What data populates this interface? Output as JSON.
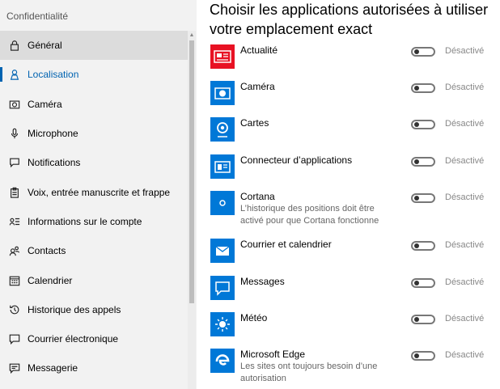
{
  "sidebar": {
    "title": "Confidentialité",
    "items": [
      {
        "label": "Général",
        "icon": "lock-icon"
      },
      {
        "label": "Localisation",
        "icon": "location-icon"
      },
      {
        "label": "Caméra",
        "icon": "camera-icon"
      },
      {
        "label": "Microphone",
        "icon": "microphone-icon"
      },
      {
        "label": "Notifications",
        "icon": "notification-icon"
      },
      {
        "label": "Voix, entrée manuscrite et frappe",
        "icon": "clipboard-icon"
      },
      {
        "label": "Informations sur le compte",
        "icon": "account-info-icon"
      },
      {
        "label": "Contacts",
        "icon": "contacts-icon"
      },
      {
        "label": "Calendrier",
        "icon": "calendar-icon"
      },
      {
        "label": "Historique des appels",
        "icon": "history-icon"
      },
      {
        "label": "Courrier électronique",
        "icon": "mail-icon"
      },
      {
        "label": "Messagerie",
        "icon": "message-icon"
      }
    ],
    "selected_index": 0,
    "active_index": 1
  },
  "main": {
    "title": "Choisir les applications autorisées à utiliser votre emplacement exact",
    "apps": [
      {
        "name": "Actualité",
        "subtitle": "",
        "toggle_label": "Désactivé",
        "icon": "news-app-icon",
        "color": "#e81123"
      },
      {
        "name": "Caméra",
        "subtitle": "",
        "toggle_label": "Désactivé",
        "icon": "camera-app-icon",
        "color": "#0078d7"
      },
      {
        "name": "Cartes",
        "subtitle": "",
        "toggle_label": "Désactivé",
        "icon": "maps-app-icon",
        "color": "#0078d7"
      },
      {
        "name": "Connecteur d’applications",
        "subtitle": "",
        "toggle_label": "Désactivé",
        "icon": "app-connector-icon",
        "color": "#0078d7"
      },
      {
        "name": "Cortana",
        "subtitle": "L’historique des positions doit être activé pour que Cortana fonctionne",
        "toggle_label": "Désactivé",
        "icon": "cortana-app-icon",
        "color": "#0078d7"
      },
      {
        "name": "Courrier et calendrier",
        "subtitle": "",
        "toggle_label": "Désactivé",
        "icon": "mail-calendar-app-icon",
        "color": "#0078d7"
      },
      {
        "name": "Messages",
        "subtitle": "",
        "toggle_label": "Désactivé",
        "icon": "messages-app-icon",
        "color": "#0078d7"
      },
      {
        "name": "Météo",
        "subtitle": "",
        "toggle_label": "Désactivé",
        "icon": "weather-app-icon",
        "color": "#0078d7"
      },
      {
        "name": "Microsoft Edge",
        "subtitle": "Les sites ont toujours besoin d’une autorisation",
        "toggle_label": "Désactivé",
        "icon": "edge-app-icon",
        "color": "#0078d7"
      }
    ]
  }
}
